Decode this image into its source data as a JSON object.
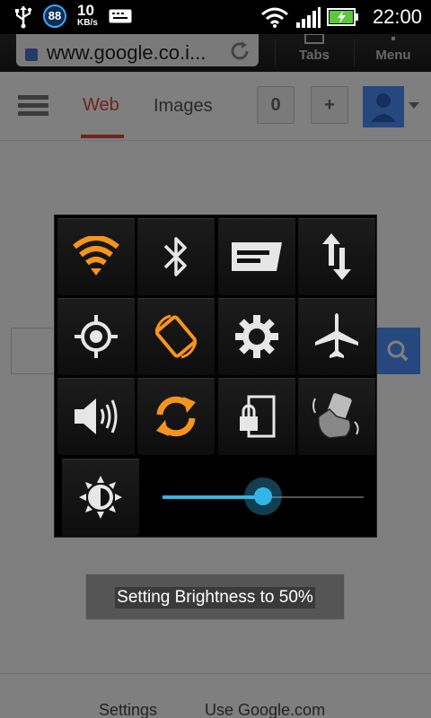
{
  "status_bar": {
    "badge_value": "88",
    "rate_value": "10",
    "rate_unit": "KB/s",
    "time": "22:00",
    "icons": [
      "usb-icon",
      "data-badge-icon",
      "keyboard-icon",
      "wifi-icon",
      "signal-icon",
      "battery-charging-icon"
    ]
  },
  "browser": {
    "url": "www.google.co.i...",
    "tabs_label": "Tabs",
    "menu_label": "Menu"
  },
  "page": {
    "nav_web": "Web",
    "nav_images": "Images",
    "count_button": "0",
    "plus_button": "+",
    "footer_settings": "Settings",
    "footer_use": "Use Google.com"
  },
  "quick_settings": {
    "tiles": [
      {
        "name": "wifi-toggle",
        "icon": "wifi-icon",
        "active": true
      },
      {
        "name": "bluetooth-toggle",
        "icon": "bluetooth-icon",
        "active": false
      },
      {
        "name": "mobile-data-toggle",
        "icon": "notification-icon",
        "active": false
      },
      {
        "name": "data-sync-toggle",
        "icon": "data-transfer-icon",
        "active": false
      },
      {
        "name": "gps-toggle",
        "icon": "gps-icon",
        "active": false
      },
      {
        "name": "auto-rotate-toggle",
        "icon": "rotate-icon",
        "active": true
      },
      {
        "name": "settings-tile",
        "icon": "gear-icon",
        "active": false
      },
      {
        "name": "airplane-mode-toggle",
        "icon": "airplane-icon",
        "active": false
      },
      {
        "name": "sound-toggle",
        "icon": "speaker-icon",
        "active": false
      },
      {
        "name": "sync-toggle",
        "icon": "sync-icon",
        "active": true
      },
      {
        "name": "screen-lock-toggle",
        "icon": "lock-icon",
        "active": false
      },
      {
        "name": "vibrate-toggle",
        "icon": "vibrate-hand-icon",
        "active": false
      }
    ],
    "brightness_icon": "brightness-icon",
    "brightness_fraction": 0.5,
    "accent": "#f7941d",
    "slider_color": "#33b5e5"
  },
  "toast": {
    "message": "Setting Brightness to 50%"
  }
}
